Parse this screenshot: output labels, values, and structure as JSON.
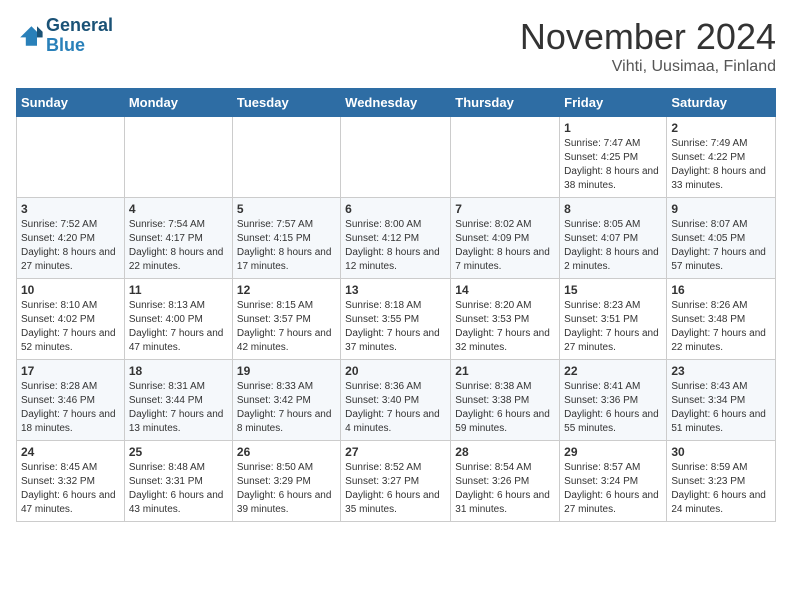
{
  "header": {
    "logo_line1": "General",
    "logo_line2": "Blue",
    "month": "November 2024",
    "location": "Vihti, Uusimaa, Finland"
  },
  "weekdays": [
    "Sunday",
    "Monday",
    "Tuesday",
    "Wednesday",
    "Thursday",
    "Friday",
    "Saturday"
  ],
  "weeks": [
    [
      {
        "day": "",
        "info": ""
      },
      {
        "day": "",
        "info": ""
      },
      {
        "day": "",
        "info": ""
      },
      {
        "day": "",
        "info": ""
      },
      {
        "day": "",
        "info": ""
      },
      {
        "day": "1",
        "info": "Sunrise: 7:47 AM\nSunset: 4:25 PM\nDaylight: 8 hours and 38 minutes."
      },
      {
        "day": "2",
        "info": "Sunrise: 7:49 AM\nSunset: 4:22 PM\nDaylight: 8 hours and 33 minutes."
      }
    ],
    [
      {
        "day": "3",
        "info": "Sunrise: 7:52 AM\nSunset: 4:20 PM\nDaylight: 8 hours and 27 minutes."
      },
      {
        "day": "4",
        "info": "Sunrise: 7:54 AM\nSunset: 4:17 PM\nDaylight: 8 hours and 22 minutes."
      },
      {
        "day": "5",
        "info": "Sunrise: 7:57 AM\nSunset: 4:15 PM\nDaylight: 8 hours and 17 minutes."
      },
      {
        "day": "6",
        "info": "Sunrise: 8:00 AM\nSunset: 4:12 PM\nDaylight: 8 hours and 12 minutes."
      },
      {
        "day": "7",
        "info": "Sunrise: 8:02 AM\nSunset: 4:09 PM\nDaylight: 8 hours and 7 minutes."
      },
      {
        "day": "8",
        "info": "Sunrise: 8:05 AM\nSunset: 4:07 PM\nDaylight: 8 hours and 2 minutes."
      },
      {
        "day": "9",
        "info": "Sunrise: 8:07 AM\nSunset: 4:05 PM\nDaylight: 7 hours and 57 minutes."
      }
    ],
    [
      {
        "day": "10",
        "info": "Sunrise: 8:10 AM\nSunset: 4:02 PM\nDaylight: 7 hours and 52 minutes."
      },
      {
        "day": "11",
        "info": "Sunrise: 8:13 AM\nSunset: 4:00 PM\nDaylight: 7 hours and 47 minutes."
      },
      {
        "day": "12",
        "info": "Sunrise: 8:15 AM\nSunset: 3:57 PM\nDaylight: 7 hours and 42 minutes."
      },
      {
        "day": "13",
        "info": "Sunrise: 8:18 AM\nSunset: 3:55 PM\nDaylight: 7 hours and 37 minutes."
      },
      {
        "day": "14",
        "info": "Sunrise: 8:20 AM\nSunset: 3:53 PM\nDaylight: 7 hours and 32 minutes."
      },
      {
        "day": "15",
        "info": "Sunrise: 8:23 AM\nSunset: 3:51 PM\nDaylight: 7 hours and 27 minutes."
      },
      {
        "day": "16",
        "info": "Sunrise: 8:26 AM\nSunset: 3:48 PM\nDaylight: 7 hours and 22 minutes."
      }
    ],
    [
      {
        "day": "17",
        "info": "Sunrise: 8:28 AM\nSunset: 3:46 PM\nDaylight: 7 hours and 18 minutes."
      },
      {
        "day": "18",
        "info": "Sunrise: 8:31 AM\nSunset: 3:44 PM\nDaylight: 7 hours and 13 minutes."
      },
      {
        "day": "19",
        "info": "Sunrise: 8:33 AM\nSunset: 3:42 PM\nDaylight: 7 hours and 8 minutes."
      },
      {
        "day": "20",
        "info": "Sunrise: 8:36 AM\nSunset: 3:40 PM\nDaylight: 7 hours and 4 minutes."
      },
      {
        "day": "21",
        "info": "Sunrise: 8:38 AM\nSunset: 3:38 PM\nDaylight: 6 hours and 59 minutes."
      },
      {
        "day": "22",
        "info": "Sunrise: 8:41 AM\nSunset: 3:36 PM\nDaylight: 6 hours and 55 minutes."
      },
      {
        "day": "23",
        "info": "Sunrise: 8:43 AM\nSunset: 3:34 PM\nDaylight: 6 hours and 51 minutes."
      }
    ],
    [
      {
        "day": "24",
        "info": "Sunrise: 8:45 AM\nSunset: 3:32 PM\nDaylight: 6 hours and 47 minutes."
      },
      {
        "day": "25",
        "info": "Sunrise: 8:48 AM\nSunset: 3:31 PM\nDaylight: 6 hours and 43 minutes."
      },
      {
        "day": "26",
        "info": "Sunrise: 8:50 AM\nSunset: 3:29 PM\nDaylight: 6 hours and 39 minutes."
      },
      {
        "day": "27",
        "info": "Sunrise: 8:52 AM\nSunset: 3:27 PM\nDaylight: 6 hours and 35 minutes."
      },
      {
        "day": "28",
        "info": "Sunrise: 8:54 AM\nSunset: 3:26 PM\nDaylight: 6 hours and 31 minutes."
      },
      {
        "day": "29",
        "info": "Sunrise: 8:57 AM\nSunset: 3:24 PM\nDaylight: 6 hours and 27 minutes."
      },
      {
        "day": "30",
        "info": "Sunrise: 8:59 AM\nSunset: 3:23 PM\nDaylight: 6 hours and 24 minutes."
      }
    ]
  ]
}
